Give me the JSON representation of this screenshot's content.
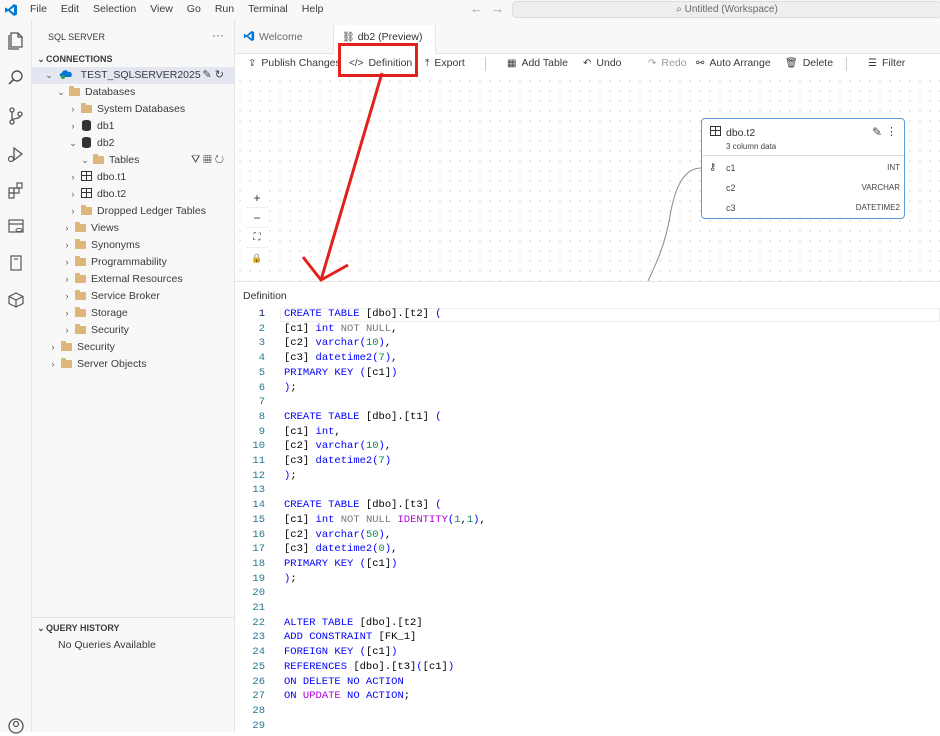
{
  "menu": [
    "File",
    "Edit",
    "Selection",
    "View",
    "Go",
    "Run",
    "Terminal",
    "Help"
  ],
  "search": {
    "text": "Untitled (Workspace)"
  },
  "sidebar": {
    "title": "SQL SERVER",
    "connections_header": "CONNECTIONS",
    "server": "TEST_SQLSERVER2025",
    "tree": {
      "databases": "Databases",
      "system_databases": "System Databases",
      "db1": "db1",
      "db2": "db2",
      "tables": "Tables",
      "t1": "dbo.t1",
      "t2": "dbo.t2",
      "dropped": "Dropped Ledger Tables",
      "views": "Views",
      "synonyms": "Synonyms",
      "programmability": "Programmability",
      "external": "External Resources",
      "service_broker": "Service Broker",
      "storage": "Storage",
      "security_db": "Security",
      "security": "Security",
      "server_objects": "Server Objects"
    },
    "query_history_header": "QUERY HISTORY",
    "query_history_empty": "No Queries Available"
  },
  "tabs": {
    "welcome": "Welcome",
    "db2": "db2 (Preview)"
  },
  "toolbar": {
    "publish": "Publish Changes",
    "definition": "Definition",
    "export": "Export",
    "add_table": "Add Table",
    "undo": "Undo",
    "redo": "Redo",
    "auto_arrange": "Auto Arrange",
    "delete": "Delete",
    "filter": "Filter"
  },
  "diagram": {
    "node": {
      "title": "dbo.t2",
      "subtitle": "3 column data",
      "columns": [
        {
          "name": "c1",
          "type": "INT"
        },
        {
          "name": "c2",
          "type": "VARCHAR"
        },
        {
          "name": "c3",
          "type": "DATETIME2"
        }
      ]
    }
  },
  "definition_title": "Definition",
  "code_lines": [
    "CREATE TABLE [dbo].[t2] (",
    "[c1] int NOT NULL,",
    "[c2] varchar(10),",
    "[c3] datetime2(7),",
    "PRIMARY KEY ([c1])",
    ");",
    "",
    "CREATE TABLE [dbo].[t1] (",
    "[c1] int,",
    "[c2] varchar(10),",
    "[c3] datetime2(7)",
    ");",
    "",
    "CREATE TABLE [dbo].[t3] (",
    "[c1] int NOT NULL IDENTITY(1,1),",
    "[c2] varchar(50),",
    "[c3] datetime2(0),",
    "PRIMARY KEY ([c1])",
    ");",
    "",
    "",
    "ALTER TABLE [dbo].[t2]",
    "ADD CONSTRAINT [FK_1]",
    "FOREIGN KEY ([c1])",
    "REFERENCES [dbo].[t3]([c1])",
    "ON DELETE NO ACTION",
    "ON UPDATE NO ACTION;",
    "",
    ""
  ],
  "colors": {
    "annotation": "#e0211c",
    "accent": "#005fb8",
    "node_border": "#5b9bd5"
  }
}
